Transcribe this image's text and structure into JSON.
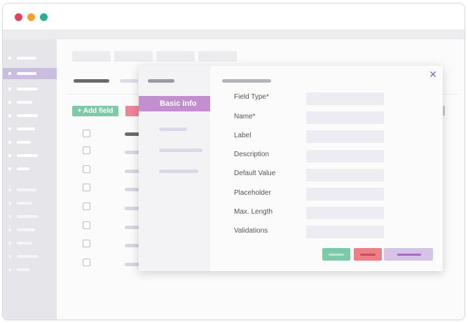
{
  "window": {
    "controls": [
      "close-dot",
      "minimize-dot",
      "maximize-dot"
    ],
    "colors": {
      "close": "#e3415b",
      "minimize": "#f2a12c",
      "maximize": "#28b38e"
    }
  },
  "toolbar": {
    "add_field_label": "+ Add field"
  },
  "modal": {
    "active_tab_label": "Basic info",
    "close_icon": "close-icon",
    "fields": [
      {
        "label": "Field Type*",
        "value": ""
      },
      {
        "label": "Name*",
        "value": ""
      },
      {
        "label": "Label",
        "value": ""
      },
      {
        "label": "Description",
        "value": ""
      },
      {
        "label": "Default Value",
        "value": ""
      },
      {
        "label": "Placeholder",
        "value": ""
      },
      {
        "label": "Max. Length",
        "value": ""
      },
      {
        "label": "Validations",
        "value": ""
      }
    ],
    "accent_colors": {
      "tab_active": "#c48fd1",
      "save": "#7ec9a7",
      "delete": "#ee7f87",
      "submit": "#d5c4e8"
    }
  }
}
